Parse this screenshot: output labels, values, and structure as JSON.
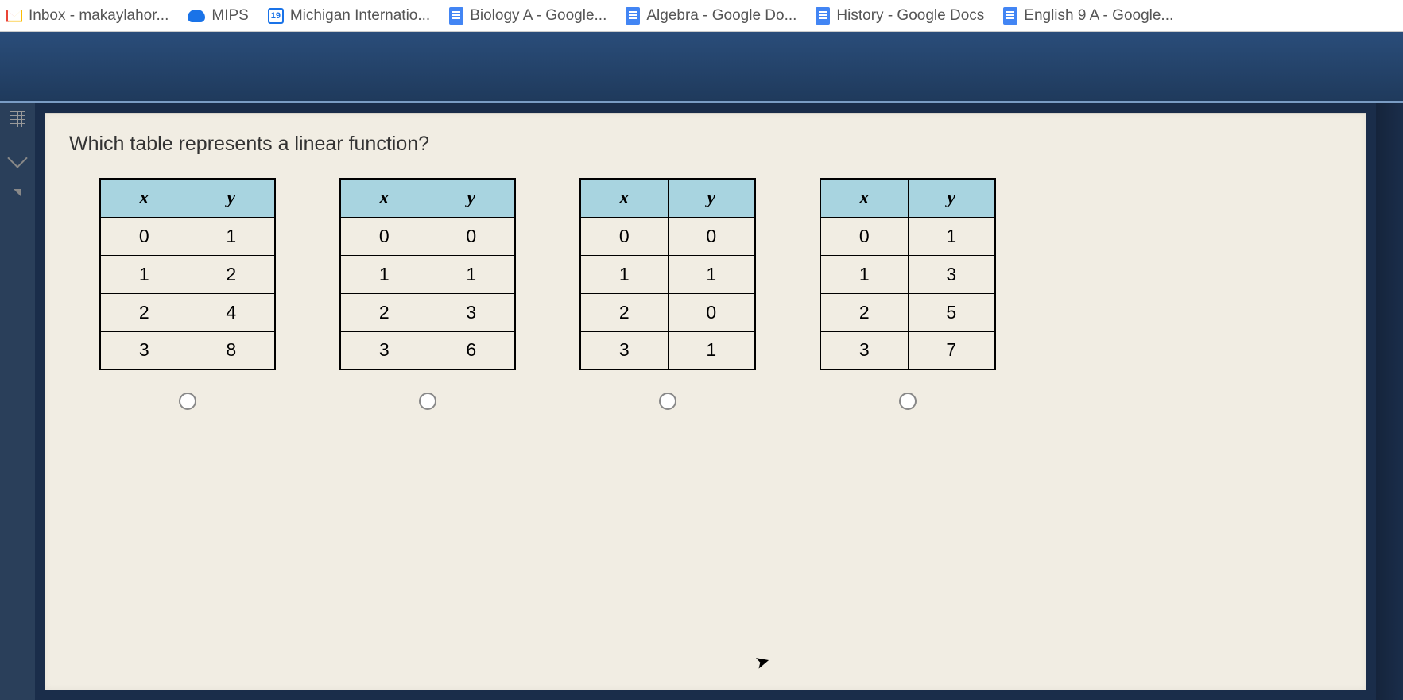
{
  "bookmarks": [
    {
      "label": "Inbox - makaylahor...",
      "icon": "gmail"
    },
    {
      "label": "MIPS",
      "icon": "cloud"
    },
    {
      "label": "Michigan Internatio...",
      "icon": "calendar",
      "badge": "19"
    },
    {
      "label": "Biology A - Google...",
      "icon": "docs"
    },
    {
      "label": "Algebra - Google Do...",
      "icon": "docs"
    },
    {
      "label": "History - Google Docs",
      "icon": "docs"
    },
    {
      "label": "English 9 A - Google...",
      "icon": "docs"
    }
  ],
  "question": "Which table represents a linear function?",
  "headers": {
    "x": "x",
    "y": "y"
  },
  "chart_data": [
    {
      "type": "table",
      "columns": [
        "x",
        "y"
      ],
      "rows": [
        [
          0,
          1
        ],
        [
          1,
          2
        ],
        [
          2,
          4
        ],
        [
          3,
          8
        ]
      ]
    },
    {
      "type": "table",
      "columns": [
        "x",
        "y"
      ],
      "rows": [
        [
          0,
          0
        ],
        [
          1,
          1
        ],
        [
          2,
          3
        ],
        [
          3,
          6
        ]
      ]
    },
    {
      "type": "table",
      "columns": [
        "x",
        "y"
      ],
      "rows": [
        [
          0,
          0
        ],
        [
          1,
          1
        ],
        [
          2,
          0
        ],
        [
          3,
          1
        ]
      ]
    },
    {
      "type": "table",
      "columns": [
        "x",
        "y"
      ],
      "rows": [
        [
          0,
          1
        ],
        [
          1,
          3
        ],
        [
          2,
          5
        ],
        [
          3,
          7
        ]
      ]
    }
  ]
}
